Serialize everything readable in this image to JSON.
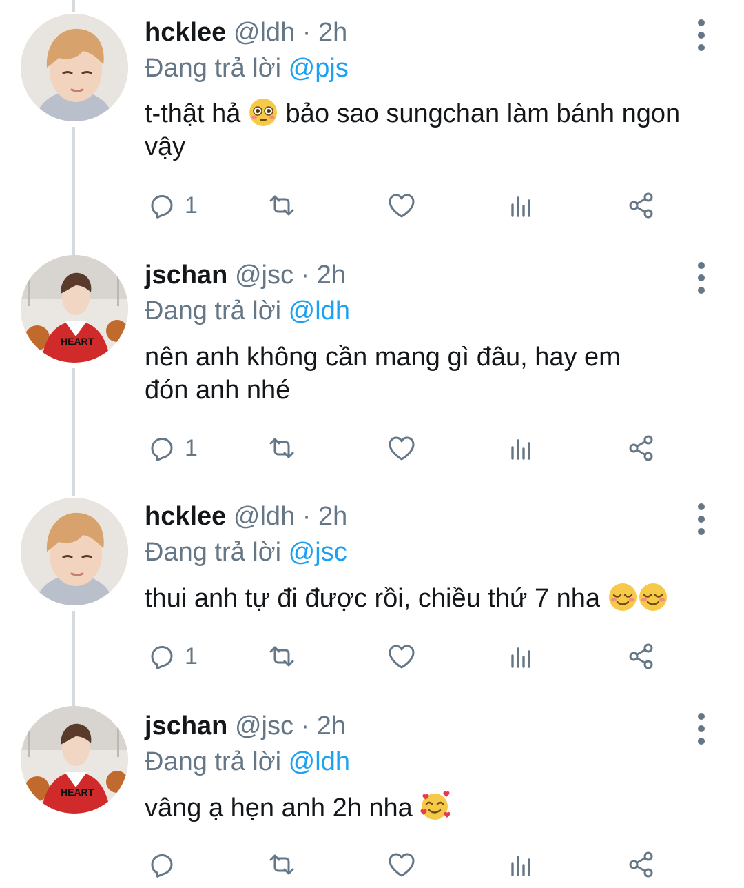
{
  "tweets": [
    {
      "name": "hcklee",
      "handle": "@ldh",
      "dot": "·",
      "time": "2h",
      "reply_prefix": "Đang trả lời",
      "reply_to": "@pjs",
      "text_parts": [
        "t-thật hả",
        "bảo sao sungchan làm bánh ngon vậy"
      ],
      "emoji": [
        "flushed-face"
      ],
      "reply_count": "1"
    },
    {
      "name": "jschan",
      "handle": "@jsc",
      "dot": "·",
      "time": "2h",
      "reply_prefix": "Đang trả lời",
      "reply_to": "@ldh",
      "text_parts": [
        "nên anh không cần mang gì đâu, hay em đón anh nhé"
      ],
      "emoji": [],
      "reply_count": "1"
    },
    {
      "name": "hcklee",
      "handle": "@ldh",
      "dot": "·",
      "time": "2h",
      "reply_prefix": "Đang trả lời",
      "reply_to": "@jsc",
      "text_parts": [
        "thui anh tự đi được rồi, chiều thứ 7 nha"
      ],
      "emoji": [
        "relieved-face",
        "relieved-face"
      ],
      "reply_count": "1"
    },
    {
      "name": "jschan",
      "handle": "@jsc",
      "dot": "·",
      "time": "2h",
      "reply_prefix": "Đang trả lời",
      "reply_to": "@ldh",
      "text_parts": [
        "vâng ạ hẹn anh 2h nha"
      ],
      "emoji": [
        "smiling-face-with-hearts"
      ],
      "reply_count": ""
    }
  ],
  "icons": {
    "reply": "reply-icon",
    "retweet": "retweet-icon",
    "like": "heart-icon",
    "analytics": "analytics-icon",
    "share": "share-icon",
    "more": "more-vertical-icon"
  },
  "colors": {
    "text": "#14171a",
    "muted": "#657786",
    "mention": "#1da1f2",
    "thread_line": "#d4dadd"
  }
}
